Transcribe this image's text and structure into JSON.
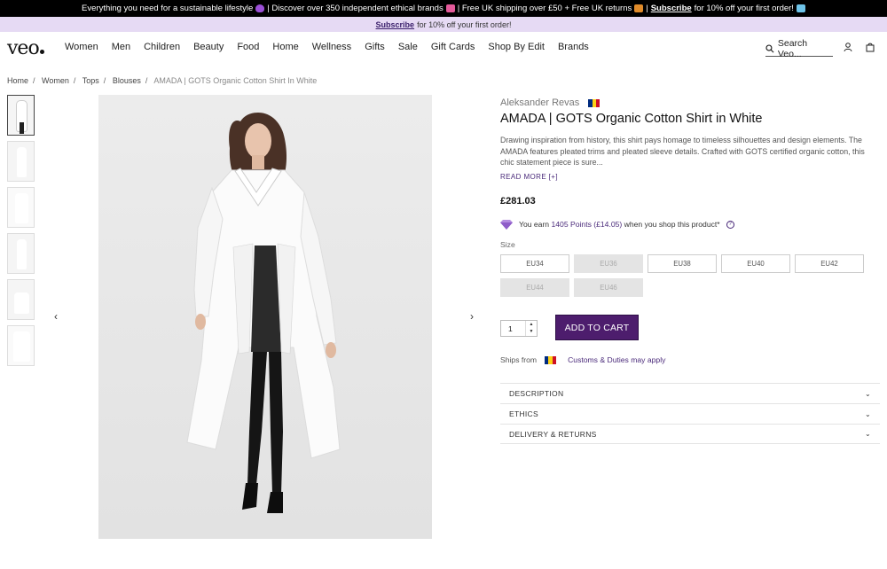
{
  "announcement": {
    "part1": "Everything you need for a sustainable lifestyle",
    "part2": "| Discover over 350 independent ethical brands",
    "part3": "| Free UK shipping over £50 + Free UK returns",
    "part4": "|",
    "subscribe": "Subscribe",
    "part5": "for 10% off your first order!"
  },
  "subbar": {
    "subscribe": "Subscribe",
    "text": "for 10% off your first order!"
  },
  "header": {
    "logo": "veo",
    "nav": [
      "Women",
      "Men",
      "Children",
      "Beauty",
      "Food",
      "Home",
      "Wellness",
      "Gifts",
      "Sale",
      "Gift Cards",
      "Shop By Edit",
      "Brands"
    ],
    "search_placeholder": "Search Veo..."
  },
  "breadcrumb": [
    "Home",
    "Women",
    "Tops",
    "Blouses",
    "AMADA | GOTS Organic Cotton Shirt In White"
  ],
  "product": {
    "brand": "Aleksander Revas",
    "title": "AMADA | GOTS Organic Cotton Shirt in White",
    "description": "Drawing inspiration from history, this shirt pays homage to timeless silhouettes and design elements. The AMADA features pleated trims and pleated sleeve details. Crafted with GOTS certified organic cotton, this chic statement piece is sure...",
    "read_more": "READ MORE [+]",
    "price": "£281.03",
    "points_prefix": "You earn",
    "points_value": "1405 Points (£14.05)",
    "points_suffix": "when you shop this product*",
    "size_label": "Size",
    "sizes": [
      {
        "label": "EU34",
        "available": true
      },
      {
        "label": "EU36",
        "available": false
      },
      {
        "label": "EU38",
        "available": true
      },
      {
        "label": "EU40",
        "available": true
      },
      {
        "label": "EU42",
        "available": true
      },
      {
        "label": "EU44",
        "available": false
      },
      {
        "label": "EU46",
        "available": false
      }
    ],
    "quantity": "1",
    "add_to_cart": "ADD TO CART",
    "ships_from": "Ships from",
    "customs": "Customs & Duties may apply",
    "accordion": [
      "DESCRIPTION",
      "ETHICS",
      "DELIVERY & RETURNS"
    ]
  },
  "colors": {
    "accent": "#4d1d6d",
    "link": "#4a2a7a",
    "subbar_bg": "#e6daf4"
  }
}
